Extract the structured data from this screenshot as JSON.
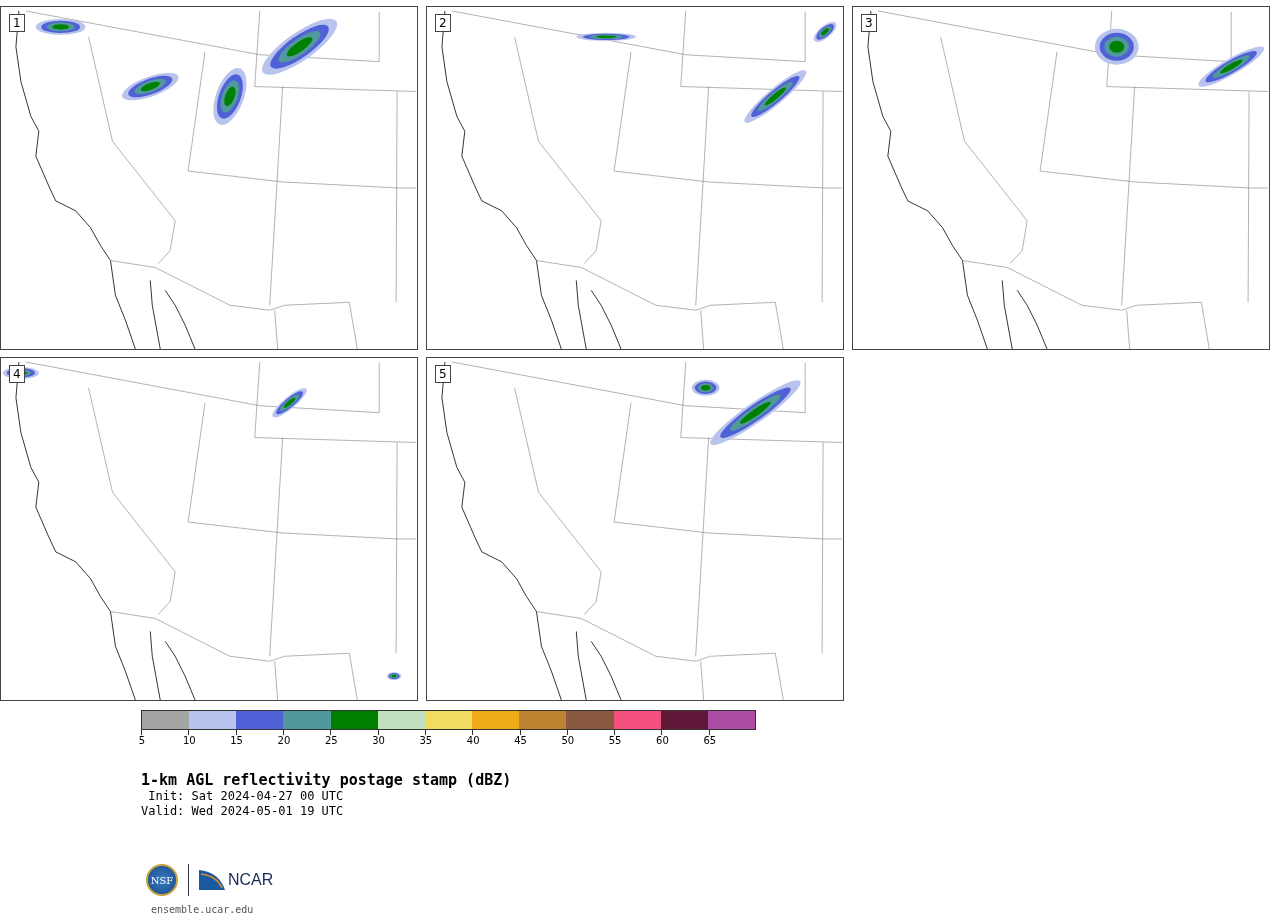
{
  "panels": [
    {
      "label": "1"
    },
    {
      "label": "2"
    },
    {
      "label": "3"
    },
    {
      "label": "4"
    },
    {
      "label": "5"
    }
  ],
  "colorbar": {
    "segments": [
      {
        "color": "#a5a5a5"
      },
      {
        "color": "#b8c4ee"
      },
      {
        "color": "#5060d6"
      },
      {
        "color": "#50989c"
      },
      {
        "color": "#008000"
      },
      {
        "color": "#c0dfbe"
      },
      {
        "color": "#f0dc60"
      },
      {
        "color": "#f0ac18"
      },
      {
        "color": "#bc8430"
      },
      {
        "color": "#8a5a40"
      },
      {
        "color": "#f65080"
      },
      {
        "color": "#601838"
      },
      {
        "color": "#ac4ca4"
      }
    ],
    "ticks": [
      "5",
      "10",
      "15",
      "20",
      "25",
      "30",
      "35",
      "40",
      "45",
      "50",
      "55",
      "60",
      "65"
    ]
  },
  "title": "1-km AGL reflectivity postage stamp (dBZ)",
  "init": " Init: Sat 2024-04-27 00 UTC",
  "valid": "Valid: Wed 2024-05-01 19 UTC",
  "logo": {
    "nsf": "NSF",
    "ncar": "NCAR"
  },
  "url": "ensemble.ucar.edu"
}
